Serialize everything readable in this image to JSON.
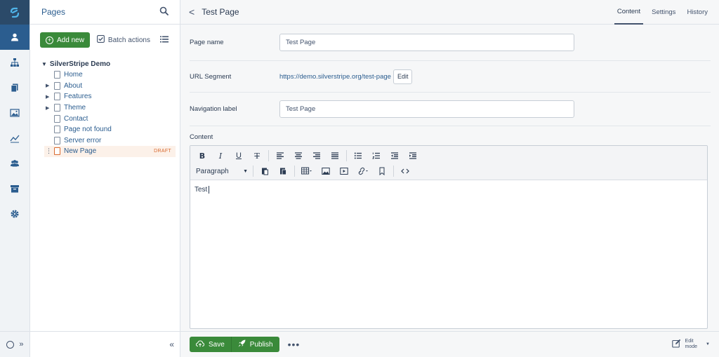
{
  "rail": {
    "items": [
      "logo-icon",
      "user-icon",
      "sitetree-icon",
      "files-icon",
      "images-icon",
      "reports-icon",
      "groups-icon",
      "archive-icon",
      "settings-icon"
    ],
    "bottom_expand": "»"
  },
  "pages_panel": {
    "title": "Pages",
    "add_new_label": "Add new",
    "batch_actions_label": "Batch actions",
    "tree_root": "SilverStripe Demo",
    "tree_items": [
      {
        "label": "Home",
        "has_children": false
      },
      {
        "label": "About",
        "has_children": true
      },
      {
        "label": "Features",
        "has_children": true
      },
      {
        "label": "Theme",
        "has_children": true
      },
      {
        "label": "Contact",
        "has_children": false
      },
      {
        "label": "Page not found",
        "has_children": false
      },
      {
        "label": "Server error",
        "has_children": false
      },
      {
        "label": "New Page",
        "has_children": false,
        "status": "DRAFT"
      }
    ],
    "collapse_label": "«"
  },
  "main": {
    "back_label": "<",
    "page_title": "Test Page",
    "tabs": [
      {
        "label": "Content",
        "active": true
      },
      {
        "label": "Settings",
        "active": false
      },
      {
        "label": "History",
        "active": false
      }
    ],
    "fields": {
      "page_name_label": "Page name",
      "page_name_value": "Test Page",
      "url_segment_label": "URL Segment",
      "url_segment_value": "https://demo.silverstripe.org/test-page",
      "url_edit_label": "Edit",
      "nav_label_label": "Navigation label",
      "nav_label_value": "Test Page",
      "content_label": "Content"
    },
    "editor": {
      "format_select": "Paragraph",
      "body_text": "Test"
    },
    "footer": {
      "save_label": "Save",
      "publish_label": "Publish",
      "more_label": "•••",
      "edit_mode_line1": "Edit",
      "edit_mode_line2": "mode"
    }
  },
  "colors": {
    "primary": "#2b5d8f",
    "success": "#3a8a3a",
    "draft": "#d9692e"
  }
}
